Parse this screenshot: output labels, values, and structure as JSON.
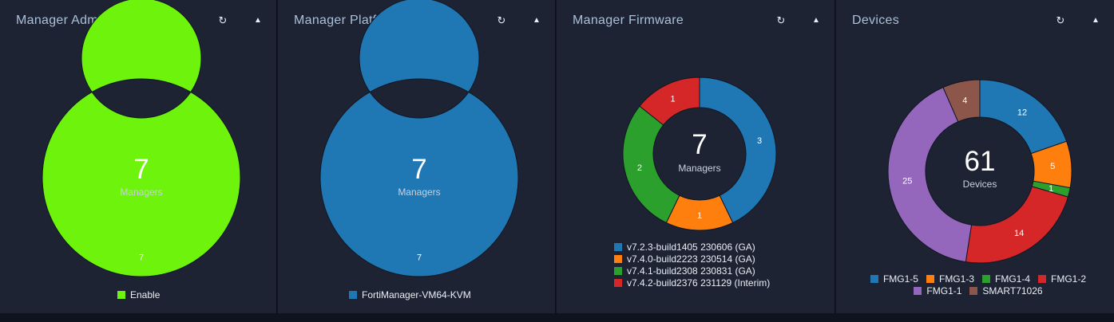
{
  "panels": [
    {
      "title": "Manager Admin Status",
      "refresh_icon": "refresh-icon",
      "collapse_icon": "caret-up-icon",
      "center_value": "7",
      "center_label": "Managers",
      "legend_layout": "inline",
      "chart_data": {
        "type": "pie",
        "title": "Manager Admin Status",
        "categories": [
          "Enable"
        ],
        "values": [
          7
        ],
        "colors": [
          "#6ef40c"
        ],
        "total": 7,
        "total_label": "Managers",
        "legend": "bottom"
      }
    },
    {
      "title": "Manager Platforms",
      "refresh_icon": "refresh-icon",
      "collapse_icon": "caret-up-icon",
      "center_value": "7",
      "center_label": "Managers",
      "legend_layout": "inline",
      "chart_data": {
        "type": "pie",
        "title": "Manager Platforms",
        "categories": [
          "FortiManager-VM64-KVM"
        ],
        "values": [
          7
        ],
        "colors": [
          "#1f77b4"
        ],
        "total": 7,
        "total_label": "Managers",
        "legend": "bottom"
      }
    },
    {
      "title": "Manager Firmware",
      "refresh_icon": "refresh-icon",
      "collapse_icon": "caret-up-icon",
      "center_value": "7",
      "center_label": "Managers",
      "legend_layout": "stacked",
      "chart_data": {
        "type": "pie",
        "title": "Manager Firmware",
        "categories": [
          "v7.2.3-build1405 230606 (GA)",
          "v7.4.0-build2223 230514 (GA)",
          "v7.4.1-build2308 230831 (GA)",
          "v7.4.2-build2376 231129 (Interim)"
        ],
        "values": [
          3,
          1,
          2,
          1
        ],
        "colors": [
          "#1f77b4",
          "#ff7f0e",
          "#2ca02c",
          "#d62728"
        ],
        "total": 7,
        "total_label": "Managers",
        "legend": "bottom"
      }
    },
    {
      "title": "Devices",
      "refresh_icon": "refresh-icon",
      "collapse_icon": "caret-up-icon",
      "center_value": "61",
      "center_label": "Devices",
      "legend_layout": "inline",
      "chart_data": {
        "type": "pie",
        "title": "Devices",
        "categories": [
          "FMG1-5",
          "FMG1-3",
          "FMG1-4",
          "FMG1-2",
          "FMG1-1",
          "SMART71026"
        ],
        "values": [
          12,
          5,
          1,
          14,
          25,
          4
        ],
        "colors": [
          "#1f77b4",
          "#ff7f0e",
          "#2ca02c",
          "#d62728",
          "#9467bd",
          "#8c564b"
        ],
        "total": 61,
        "total_label": "Devices",
        "legend": "bottom"
      }
    }
  ]
}
